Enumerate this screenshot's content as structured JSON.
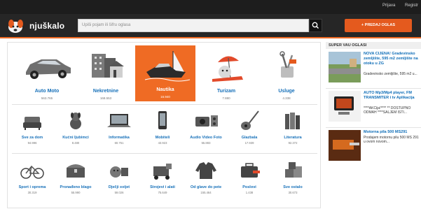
{
  "topbar": {
    "login": "Prijava",
    "register": "Registr"
  },
  "header": {
    "logo_text": "njuškalo",
    "search_placeholder": "Upiši pojam ili šifru oglasa",
    "post_button": "+ PREDAJ OGLAS"
  },
  "main_categories": [
    {
      "name": "Auto Moto",
      "count": "563.765",
      "icon": "car-icon"
    },
    {
      "name": "Nekretnine",
      "count": "168.553",
      "icon": "buildings-icon"
    },
    {
      "name": "Nautika",
      "count": "16.940",
      "icon": "boat-icon",
      "active": true
    },
    {
      "name": "Turizam",
      "count": "7.880",
      "icon": "beach-icon"
    },
    {
      "name": "Usluge",
      "count": "4.338",
      "icon": "tools-icon"
    }
  ],
  "row2": [
    {
      "name": "Sve za dom",
      "count": "94.996",
      "icon": "sofa-icon"
    },
    {
      "name": "Kućni ljubimci",
      "count": "8.480",
      "icon": "dog-icon"
    },
    {
      "name": "Informatika",
      "count": "60.751",
      "icon": "laptop-icon"
    },
    {
      "name": "Mobiteli",
      "count": "43.923",
      "icon": "phone-icon"
    },
    {
      "name": "Audio Video Foto",
      "count": "55.883",
      "icon": "camera-icon"
    },
    {
      "name": "Glazbala",
      "count": "17.939",
      "icon": "guitar-icon"
    },
    {
      "name": "Literatura",
      "count": "92.372",
      "icon": "books-icon"
    }
  ],
  "row3": [
    {
      "name": "Sport i oprema",
      "count": "30.319",
      "icon": "bicycle-icon"
    },
    {
      "name": "Pronađeno blago",
      "count": "55.990",
      "icon": "chest-icon"
    },
    {
      "name": "Dječji svijet",
      "count": "59.026",
      "icon": "toys-icon"
    },
    {
      "name": "Strojevi i alati",
      "count": "75.649",
      "icon": "machine-icon"
    },
    {
      "name": "Od glave do pete",
      "count": "155.464",
      "icon": "jacket-icon"
    },
    {
      "name": "Poslovi",
      "count": "1.438",
      "icon": "briefcase-icon"
    },
    {
      "name": "Sve ostalo",
      "count": "30.673",
      "icon": "boxes-icon"
    }
  ],
  "sidebar": {
    "heading": "SUPER VAU OGLASI",
    "ads": [
      {
        "title": "NOVA CIJENA! Gradevinsko zemljište, 595 m2 zemljište na otoku u ZG",
        "desc": "Gradevinsko zemljište, 595 m2 u..."
      },
      {
        "title": "AUTO Mp3/Mp4 player, FM TRANSMITER i tv Aplikacija",
        "desc": "****AKCija!****  ** DOSTUPNO ODMAH  ****SALJEM ISTI..."
      },
      {
        "title": "Motorna pila 500 MS291",
        "desc": "Prodajem motornu pilu 500 MS 291 u ovom novom..."
      }
    ]
  }
}
